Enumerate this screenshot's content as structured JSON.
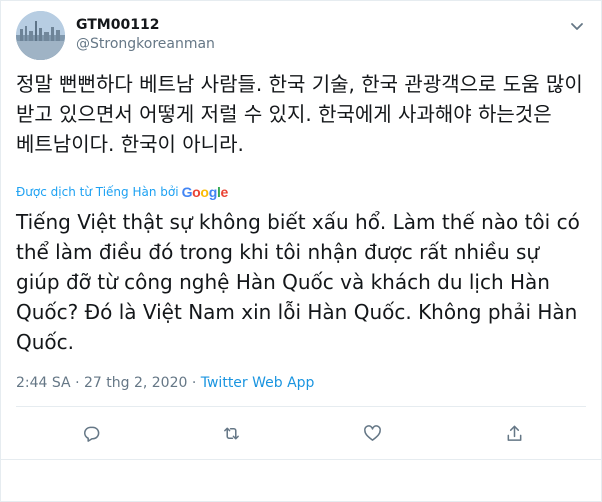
{
  "author": {
    "display_name": "GTM00112",
    "handle": "@Strongkoreanman",
    "avatar_icon": "city-skyline-avatar"
  },
  "tweet": {
    "text": "정말 뻔뻔하다 베트남 사람들. 한국 기술, 한국 관광객으로 도움 많이 받고 있으면서 어떻게 저럴 수 있지. 한국에게 사과해야 하는것은 베트남이다. 한국이 아니라.",
    "translation_label": "Được dịch từ Tiếng Hàn bởi",
    "translation_provider": "Google",
    "translated_text": "Tiếng Việt thật sự không biết xấu hổ. Làm thế nào tôi có thể làm điều đó trong khi tôi nhận được rất nhiều sự giúp đỡ từ công nghệ Hàn Quốc và khách du lịch Hàn Quốc? Đó là Việt Nam xin lỗi Hàn Quốc. Không phải Hàn Quốc."
  },
  "meta": {
    "time": "2:44 SA",
    "separator": "·",
    "date": "27 thg 2, 2020",
    "source": "Twitter Web App"
  },
  "actions": {
    "reply_icon": "reply-icon",
    "retweet_icon": "retweet-icon",
    "like_icon": "heart-icon",
    "share_icon": "share-icon"
  },
  "colors": {
    "link": "#1da1f2",
    "text": "#14171a",
    "muted": "#657786",
    "border": "#e6ecf0"
  }
}
